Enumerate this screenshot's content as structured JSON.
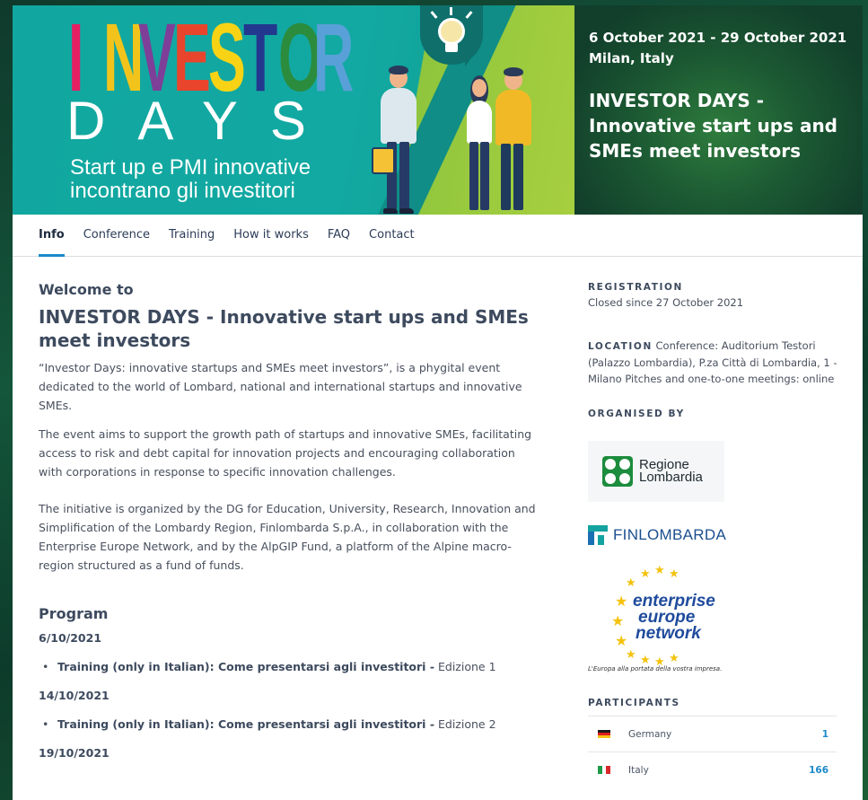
{
  "hero": {
    "logo_word": [
      "I",
      "N",
      "V",
      "E",
      "S",
      "T",
      "O",
      "R"
    ],
    "logo_colors": [
      "#e61f63",
      "#f2c41b",
      "#7e3f98",
      "#e8452c",
      "#f8d315",
      "#23378f",
      "#2b8c3e",
      "#5aa0d8"
    ],
    "logo_days": "DAYS",
    "tagline_line1": "Start up e PMI innovative",
    "tagline_line2": "incontrano gli investitori",
    "date_range": "6 October 2021 - 29 October 2021",
    "location": "Milan, Italy",
    "event_title": "INVESTOR DAYS - Innovative start ups and SMEs meet investors"
  },
  "tabs": [
    {
      "label": "Info",
      "active": true
    },
    {
      "label": "Conference",
      "active": false
    },
    {
      "label": "Training",
      "active": false
    },
    {
      "label": "How it works",
      "active": false
    },
    {
      "label": "FAQ",
      "active": false
    },
    {
      "label": "Contact",
      "active": false
    }
  ],
  "main": {
    "welcome": "Welcome to",
    "title": "INVESTOR DAYS - Innovative start ups and SMEs meet investors",
    "paragraphs": [
      "“Investor Days: innovative startups and SMEs meet investors”, is a phygital event dedicated to the world of Lombard, national and international startups and innovative SMEs.",
      "The event aims to support the growth path of startups and innovative SMEs, facilitating access to risk and debt capital for innovation projects and encouraging collaboration with corporations in response to specific innovation challenges.",
      "The initiative is organized by the DG for Education, University, Research, Innovation and Simplification of the Lombardy Region, Finlombarda S.p.A., in collaboration with the Enterprise Europe Network, and by the AlpGIP Fund, a platform of the Alpine macro-region structured as a fund of funds."
    ],
    "program_heading": "Program",
    "program": [
      {
        "date": "6/10/2021",
        "item_bold": "Training (only in Italian): Come presentarsi agli investitori -",
        "item_rest": " Edizione 1"
      },
      {
        "date": "14/10/2021",
        "item_bold": "Training (only in Italian): Come presentarsi agli investitori -",
        "item_rest": " Edizione 2"
      },
      {
        "date": "19/10/2021"
      }
    ]
  },
  "sidebar": {
    "registration_label": "REGISTRATION",
    "registration_text": "Closed since 27 October 2021",
    "location_label": "LOCATION",
    "location_text": " Conference: Auditorium Testori (Palazzo Lombardia), P.za Città di Lombardia, 1 - Milano Pitches and one-to-one meetings: online",
    "organised_label": "ORGANISED BY",
    "org_regione_line1": "Regione",
    "org_regione_line2": "Lombardia",
    "org_finlombarda": "FINLOMBARDA",
    "org_een_line1": "enterprise",
    "org_een_line2": "europe",
    "org_een_line3": "network",
    "org_een_tagline": "L'Europa alla portata della vostra impresa.",
    "participants_label": "PARTICIPANTS",
    "participants": [
      {
        "country": "Germany",
        "count": "1",
        "flag_colors": [
          "#1a1a1a",
          "#dd1e1e",
          "#f6c418"
        ]
      },
      {
        "country": "Italy",
        "count": "166",
        "flag_colors": [
          "#1f9a48",
          "#ffffff",
          "#d8282c"
        ]
      }
    ]
  }
}
